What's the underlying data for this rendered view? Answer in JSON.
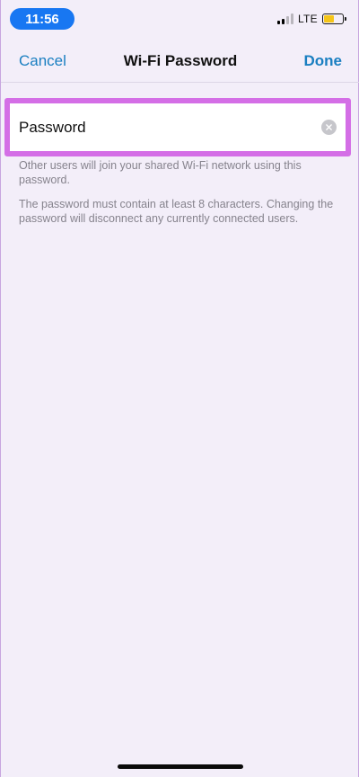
{
  "status_bar": {
    "time": "11:56",
    "network": "LTE",
    "battery_level": 0.55,
    "signal_bars_active": 2
  },
  "nav": {
    "cancel_label": "Cancel",
    "title": "Wi-Fi Password",
    "done_label": "Done"
  },
  "password_field": {
    "placeholder": "Password",
    "value": ""
  },
  "notes": {
    "shared": "Other users will join your shared Wi-Fi network using this password.",
    "requirement": "The password must contain at least 8 characters. Changing the password will disconnect any currently connected users."
  },
  "colors": {
    "accent": "#1a7fc1",
    "highlight": "#d46ee6",
    "time_pill": "#1877f2",
    "battery": "#f5c518"
  },
  "icons": {
    "clear": "clear-text-icon",
    "signal": "cellular-signal-icon",
    "battery": "battery-icon"
  }
}
